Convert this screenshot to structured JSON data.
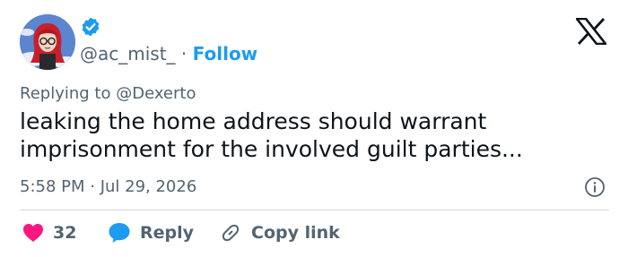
{
  "user": {
    "handle": "@ac_mist_",
    "separator": "·",
    "follow_label": "Follow",
    "avatar_icon": "avatar-image",
    "verified_icon": "verified-badge-icon"
  },
  "reply_to": {
    "prefix": "Replying to",
    "handle": "@Dexerto"
  },
  "tweet": {
    "lines": [
      "leaking the home address should warrant",
      "imprisonment for the involved guilt parties..."
    ],
    "timestamp": "5:58 PM · Jul 29, 2026"
  },
  "actions": {
    "like_count": "32",
    "reply_label": "Reply",
    "copy_label": "Copy link"
  },
  "colors": {
    "accent": "#1d9bf0",
    "like": "#f91880",
    "muted": "#536471",
    "text": "#0f1419"
  }
}
